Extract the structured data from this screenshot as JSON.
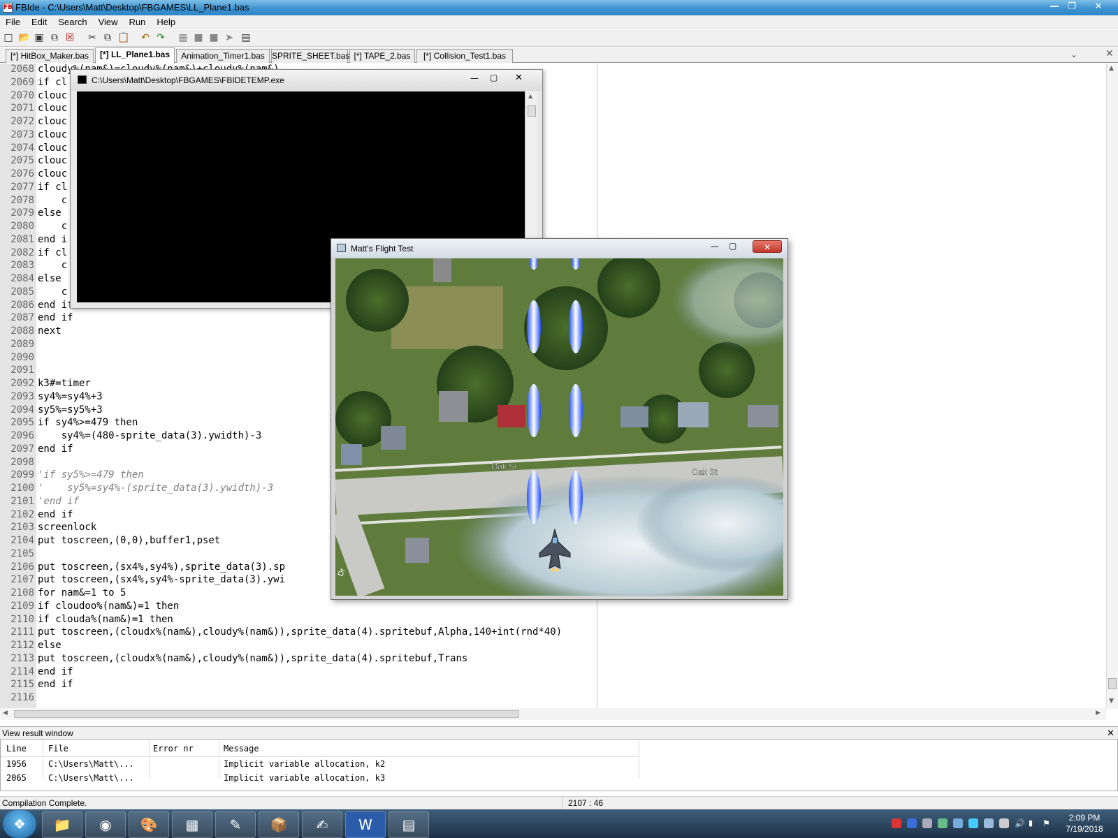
{
  "window": {
    "title": "FBIde - C:\\Users\\Matt\\Desktop\\FBGAMES\\LL_Plane1.bas",
    "app_icon": "FB"
  },
  "menu": [
    "File",
    "Edit",
    "Search",
    "View",
    "Run",
    "Help"
  ],
  "toolbar_icons": [
    "new-file-icon",
    "open-file-icon",
    "save-icon",
    "save-all-icon",
    "close-file-icon",
    "cut-icon",
    "copy-icon",
    "paste-icon",
    "undo-icon",
    "redo-icon",
    "compile-icon",
    "run-icon",
    "stop-icon",
    "next-icon",
    "terminal-icon"
  ],
  "tabs": [
    {
      "label": "[*] HitBox_Maker.bas",
      "active": false
    },
    {
      "label": "[*] LL_Plane1.bas",
      "active": true
    },
    {
      "label": "Animation_Timer1.bas",
      "active": false
    },
    {
      "label": "SPRITE_SHEET.bas",
      "active": false
    },
    {
      "label": "[*] TAPE_2.bas",
      "active": false
    },
    {
      "label": "[*] Collision_Test1.bas",
      "active": false
    }
  ],
  "editor": {
    "lines": [
      {
        "n": "2068",
        "text": "cloudy%(nam&)=cloudy%(nam&)+cloudv%(nam&)"
      },
      {
        "n": "2069",
        "text": "if cl"
      },
      {
        "n": "2070",
        "text": "clouc"
      },
      {
        "n": "2071",
        "text": "clouc"
      },
      {
        "n": "2072",
        "text": "clouc"
      },
      {
        "n": "2073",
        "text": "clouc"
      },
      {
        "n": "2074",
        "text": "clouc"
      },
      {
        "n": "2075",
        "text": "clouc"
      },
      {
        "n": "2076",
        "text": "clouc"
      },
      {
        "n": "2077",
        "text": "if cl"
      },
      {
        "n": "2078",
        "text": "    c"
      },
      {
        "n": "2079",
        "text": "else"
      },
      {
        "n": "2080",
        "text": "    c"
      },
      {
        "n": "2081",
        "text": "end i"
      },
      {
        "n": "2082",
        "text": "if cl"
      },
      {
        "n": "2083",
        "text": "    c"
      },
      {
        "n": "2084",
        "text": "else"
      },
      {
        "n": "2085",
        "text": "    c"
      },
      {
        "n": "2086",
        "text": "end if"
      },
      {
        "n": "2087",
        "text": "end if"
      },
      {
        "n": "2088",
        "text": "next"
      },
      {
        "n": "2089",
        "text": ""
      },
      {
        "n": "2090",
        "text": ""
      },
      {
        "n": "2091",
        "text": ""
      },
      {
        "n": "2092",
        "text": "k3#=timer"
      },
      {
        "n": "2093",
        "text": "sy4%=sy4%+3"
      },
      {
        "n": "2094",
        "text": "sy5%=sy5%+3"
      },
      {
        "n": "2095",
        "text": "if sy4%>=479 then"
      },
      {
        "n": "2096",
        "text": "    sy4%=(480-sprite_data(3).ywidth)-3"
      },
      {
        "n": "2097",
        "text": "end if"
      },
      {
        "n": "2098",
        "text": ""
      },
      {
        "n": "2099",
        "text": "'if sy5%>=479 then"
      },
      {
        "n": "2100",
        "text": "'    sy5%=sy4%-(sprite_data(3).ywidth)-3"
      },
      {
        "n": "2101",
        "text": "'end if"
      },
      {
        "n": "2102",
        "text": "end if"
      },
      {
        "n": "2103",
        "text": "screenlock"
      },
      {
        "n": "2104",
        "text": "put toscreen,(0,0),buffer1,pset"
      },
      {
        "n": "2105",
        "text": ""
      },
      {
        "n": "2106",
        "text": "put toscreen,(sx4%,sy4%),sprite_data(3).sp"
      },
      {
        "n": "2107",
        "text": "put toscreen,(sx4%,sy4%-sprite_data(3).ywi"
      },
      {
        "n": "2108",
        "text": "for nam&=1 to 5"
      },
      {
        "n": "2109",
        "text": "if cloudoo%(nam&)=1 then"
      },
      {
        "n": "2110",
        "text": "if clouda%(nam&)=1 then"
      },
      {
        "n": "2111",
        "text": "put toscreen,(cloudx%(nam&),cloudy%(nam&)),sprite_data(4).spritebuf,Alpha,140+int(rnd*40)"
      },
      {
        "n": "2112",
        "text": "else"
      },
      {
        "n": "2113",
        "text": "put toscreen,(cloudx%(nam&),cloudy%(nam&)),sprite_data(4).spritebuf,Trans"
      },
      {
        "n": "2114",
        "text": "end if"
      },
      {
        "n": "2115",
        "text": "end if"
      },
      {
        "n": "2116",
        "text": ""
      }
    ]
  },
  "console_window": {
    "title": "C:\\Users\\Matt\\Desktop\\FBGAMES\\FBIDETEMP.exe"
  },
  "game_window": {
    "title": "Matt's Flight Test",
    "street_labels": [
      "Oak St",
      "Oak St"
    ],
    "road_label_partial": "Dr"
  },
  "results": {
    "panel_title": "View result window",
    "columns": [
      "Line",
      "File",
      "Error nr",
      "Message"
    ],
    "rows": [
      {
        "line": "1956",
        "file": "C:\\Users\\Matt\\...",
        "error": "",
        "message": "Implicit variable allocation, k2"
      },
      {
        "line": "2065",
        "file": "C:\\Users\\Matt\\...",
        "error": "",
        "message": "Implicit variable allocation, k3"
      }
    ]
  },
  "status": {
    "message": "Compilation Complete.",
    "cursor": "2107 : 46"
  },
  "taskbar": {
    "apps": [
      "file-explorer-icon",
      "chrome-icon",
      "paint-icon",
      "calculator-icon",
      "notepad-icon",
      "installer-icon",
      "fbide-icon",
      "word-icon",
      "app-window-icon"
    ],
    "time": "2:09 PM",
    "date": "7/19/2018"
  }
}
